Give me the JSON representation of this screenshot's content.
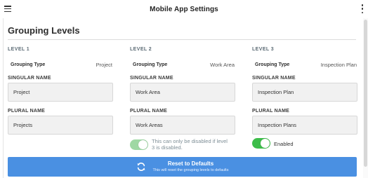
{
  "app": {
    "title": "Mobile App Settings",
    "menu_icon": "hamburger-menu-icon",
    "more_icon": "vertical-dots-icon"
  },
  "section": {
    "title": "Grouping Levels"
  },
  "levels": [
    {
      "level_label": "LEVEL 1",
      "grouping_type_label": "Grouping Type",
      "grouping_type_value": "Project",
      "singular_label": "SINGULAR NAME",
      "singular_value": "Project",
      "plural_label": "PLURAL NAME",
      "plural_value": "Projects"
    },
    {
      "level_label": "LEVEL 2",
      "grouping_type_label": "Grouping Type",
      "grouping_type_value": "Work Area",
      "singular_label": "SINGULAR NAME",
      "singular_value": "Work Area",
      "plural_label": "PLURAL NAME",
      "plural_value": "Work Areas",
      "toggle_on": true,
      "toggle_disabled": true,
      "toggle_text_line1": "This can only be disabled if level",
      "toggle_text_line2": "3 is disabled."
    },
    {
      "level_label": "LEVEL 3",
      "grouping_type_label": "Grouping Type",
      "grouping_type_value": "Inspection Plan",
      "singular_label": "SINGULAR NAME",
      "singular_value": "Inspection Plan",
      "plural_label": "PLURAL NAME",
      "plural_value": "Inspection Plans",
      "toggle_on": true,
      "toggle_disabled": false,
      "toggle_text": "Enabled"
    }
  ],
  "reset": {
    "label": "Reset to Defaults",
    "sublabel": "This will reset the grouping levels to defaults",
    "icon": "refresh-icon"
  },
  "colors": {
    "primary_button": "#4a90e2",
    "toggle_on": "#3dbd4a",
    "toggle_disabled": "#9fd8a4"
  }
}
